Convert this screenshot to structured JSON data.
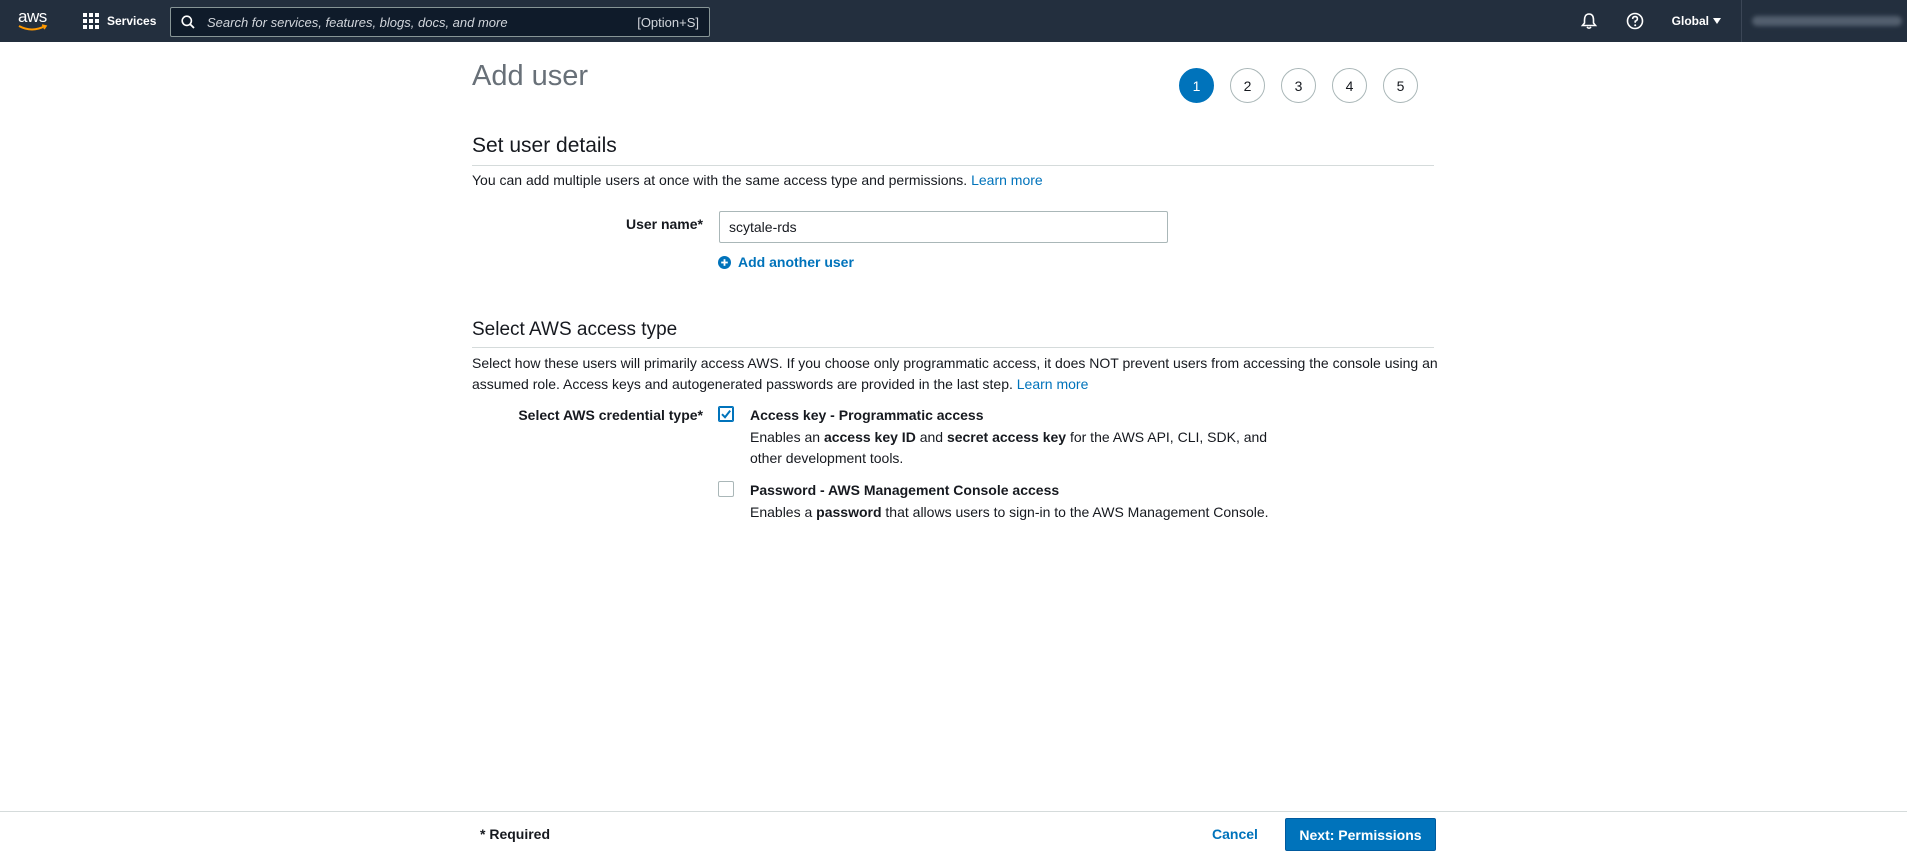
{
  "nav": {
    "logo_text": "aws",
    "services_label": "Services",
    "search_placeholder": "Search for services, features, blogs, docs, and more",
    "search_shortcut": "[Option+S]",
    "region_label": "Global",
    "icons": [
      "bell-icon",
      "help-icon"
    ]
  },
  "page": {
    "title": "Add user",
    "steps": [
      "1",
      "2",
      "3",
      "4",
      "5"
    ],
    "active_step": "1"
  },
  "user_details": {
    "title": "Set user details",
    "description": "You can add multiple users at once with the same access type and permissions.",
    "learn_more": "Learn more",
    "username_label": "User name*",
    "username_value": "scytale-rds",
    "add_another_user": "Add another user"
  },
  "access_type": {
    "title": "Select AWS access type",
    "description": "Select how these users will primarily access AWS. If you choose only programmatic access, it does NOT prevent users from accessing the console using an assumed role. Access keys and autogenerated passwords are provided in the last step.",
    "learn_more": "Learn more",
    "credential_label": "Select AWS credential type*",
    "options": [
      {
        "title": "Access key - Programmatic access",
        "desc_parts": [
          "Enables an ",
          "access key ID",
          " and ",
          "secret access key",
          " for the AWS API, CLI, SDK, and",
          "other development tools."
        ],
        "checked": true
      },
      {
        "title": "Password - AWS Management Console access",
        "desc_parts": [
          "Enables a ",
          "password",
          " that allows users to sign-in to the AWS Management Console."
        ],
        "checked": false
      }
    ]
  },
  "footer": {
    "required_note": "* Required",
    "cancel_label": "Cancel",
    "next_label": "Next: Permissions"
  },
  "colors": {
    "nav_bg": "#232f3e",
    "link": "#0073bb",
    "primary_button": "#0073bb"
  }
}
